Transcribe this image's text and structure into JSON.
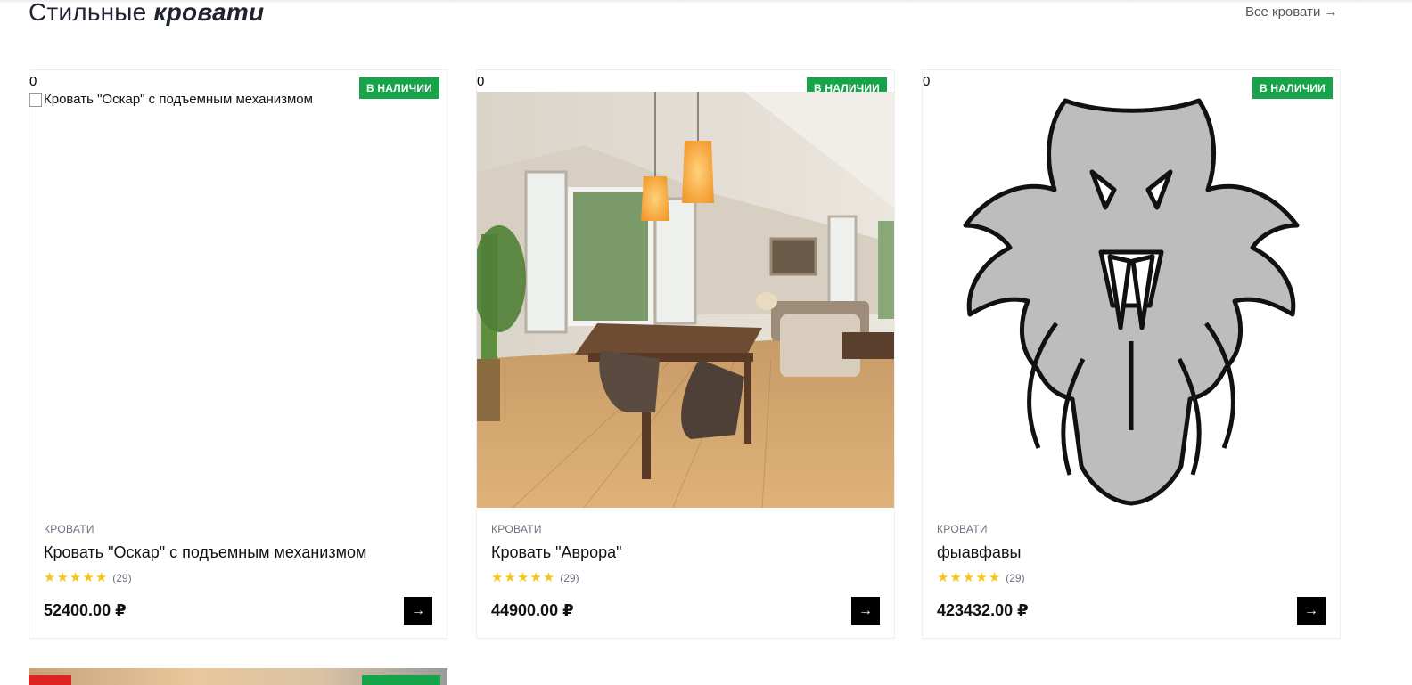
{
  "section": {
    "title_plain": "Стильные",
    "title_emph": "кровати",
    "all_link": "Все кровати",
    "all_link_icon": "arrow-right-icon"
  },
  "products": [
    {
      "counter": "0",
      "badge": "В НАЛИЧИИ",
      "image_alt": "Кровать \"Оскар\" с подъемным механизмом",
      "image_state": "broken",
      "category": "КРОВАТИ",
      "title": "Кровать \"Оскар\" с подъемным механизмом",
      "rating_stars": 5,
      "reviews": "(29)",
      "price": "52400.00 ₽"
    },
    {
      "counter": "0",
      "badge": "В НАЛИЧИИ",
      "image_state": "interior-photo",
      "category": "КРОВАТИ",
      "title": "Кровать \"Аврора\"",
      "rating_stars": 5,
      "reviews": "(29)",
      "price": "44900.00 ₽"
    },
    {
      "counter": "0",
      "badge": "В НАЛИЧИИ",
      "image_state": "tiger-drawing",
      "category": "КРОВАТИ",
      "title": "фыавфавы",
      "rating_stars": 5,
      "reviews": "(29)",
      "price": "423432.00 ₽"
    }
  ],
  "colors": {
    "badge_green": "#16a34a",
    "star_yellow": "#f5c518",
    "sale_red": "#dc2626"
  }
}
